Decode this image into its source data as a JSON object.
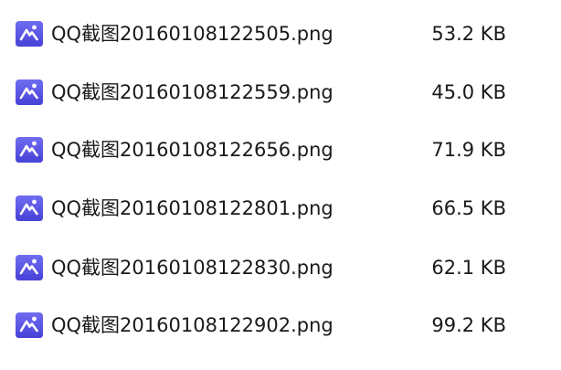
{
  "files": [
    {
      "name": "QQ截图20160108122505.png",
      "size": "53.2 KB",
      "icon": "image-file-icon"
    },
    {
      "name": "QQ截图20160108122559.png",
      "size": "45.0 KB",
      "icon": "image-file-icon"
    },
    {
      "name": "QQ截图20160108122656.png",
      "size": "71.9 KB",
      "icon": "image-file-icon"
    },
    {
      "name": "QQ截图20160108122801.png",
      "size": "66.5 KB",
      "icon": "image-file-icon"
    },
    {
      "name": "QQ截图20160108122830.png",
      "size": "62.1 KB",
      "icon": "image-file-icon"
    },
    {
      "name": "QQ截图20160108122902.png",
      "size": "99.2 KB",
      "icon": "image-file-icon"
    }
  ],
  "colors": {
    "icon_top": "#6f6cf0",
    "icon_bottom": "#4a44d8",
    "icon_mark": "#ffffff",
    "text": "#1a1a1a",
    "background": "#ffffff"
  }
}
